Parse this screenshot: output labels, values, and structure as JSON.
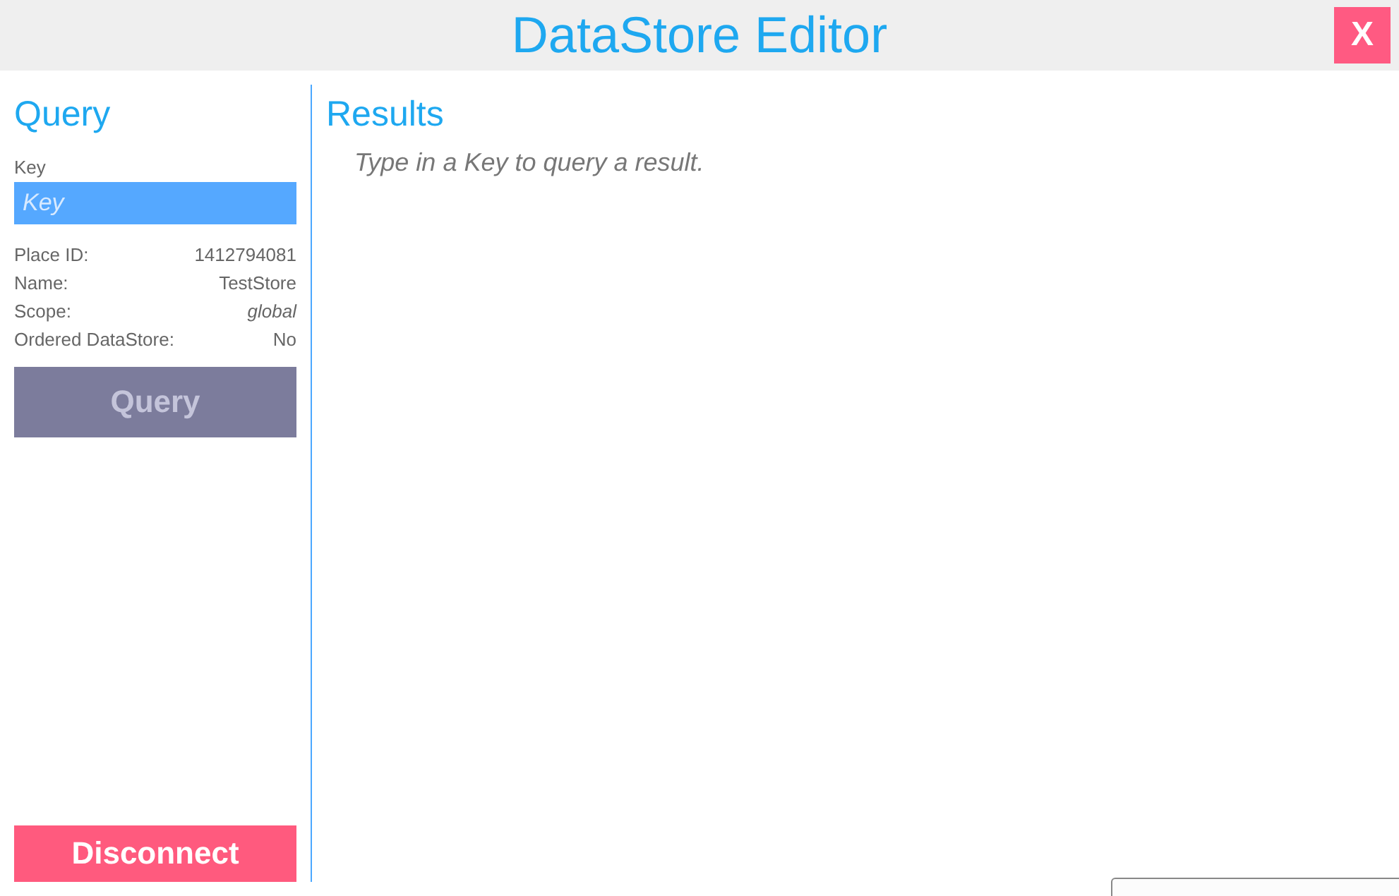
{
  "window": {
    "title": "DataStore Editor",
    "close_label": "X"
  },
  "query_panel": {
    "title": "Query",
    "key_label": "Key",
    "key_field": {
      "placeholder": "Key"
    },
    "info": [
      {
        "label": "Place ID:",
        "value": "1412794081",
        "emphasis": false
      },
      {
        "label": "Name:",
        "value": "TestStore",
        "emphasis": false
      },
      {
        "label": "Scope:",
        "value": "global",
        "emphasis": true
      },
      {
        "label": "Ordered DataStore:",
        "value": "No",
        "emphasis": false
      }
    ],
    "query_button": {
      "label": "Query",
      "disabled": true
    },
    "disconnect_button": {
      "label": "Disconnect",
      "disabled": false
    }
  },
  "results_panel": {
    "title": "Results",
    "message": "Type in a Key to query a result."
  }
}
